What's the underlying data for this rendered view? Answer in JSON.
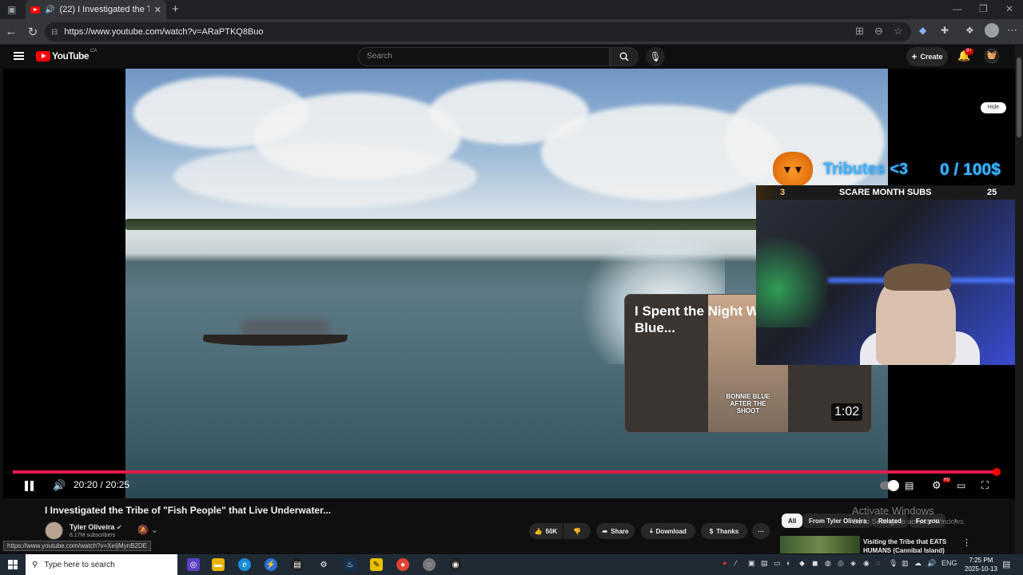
{
  "browser": {
    "tab_title": "(22) I Investigated the Tribe",
    "url": "https://www.youtube.com/watch?v=ARaPTKQ8Buo",
    "status_url": "https://www.youtube.com/watch?v=XeIjMynB2DE"
  },
  "header": {
    "logo_text": "YouTube",
    "region": "CA",
    "search_placeholder": "Search",
    "create_label": "Create",
    "notifications_badge": "9+"
  },
  "overlay": {
    "hide_label": "Hide",
    "tributes_text": "Tributes <3",
    "tributes_goal": "0  / 100$",
    "subs_count_left": "3",
    "subs_label": "SCARE MONTH SUBS",
    "subs_count_right": "25"
  },
  "promo": {
    "title": "I Spent the Night W Blue...",
    "thumb_text": "BONNIE BLUE AFTER THE SHOOT",
    "duration": "1:02"
  },
  "player": {
    "time_current": "20:20",
    "time_total": "20:25",
    "progress": 0.996
  },
  "video": {
    "title": "I Investigated the Tribe of \"Fish People\" that Live Underwater...",
    "channel": "Tyler Oliveira",
    "subscribers": "8.17M subscribers",
    "likes": "50K",
    "share_label": "Share",
    "download_label": "Download",
    "thanks_label": "Thanks"
  },
  "watermark": {
    "line1": "Activate Windows",
    "line2": "Go to Settings to activate Windows."
  },
  "chips": [
    "All",
    "From Tyler Oliveira",
    "Related",
    "For you"
  ],
  "related": {
    "title": "Visiting the Tribe that EATS HUMANS (Cannibal Island)"
  },
  "taskbar": {
    "search_placeholder": "Type here to search",
    "lang": "ENG",
    "time": "7:25 PM",
    "date": "2025-10-13"
  }
}
